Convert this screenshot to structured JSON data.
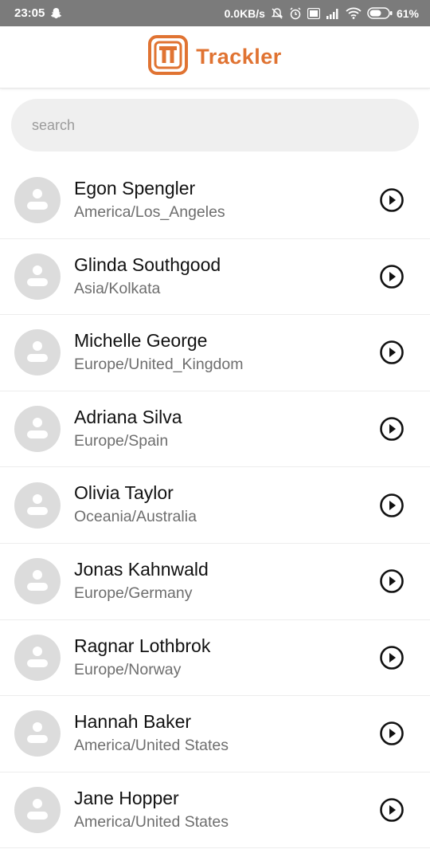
{
  "status_bar": {
    "time": "23:05",
    "speed": "0.0KB/s",
    "battery": "61%",
    "icons": [
      "snapchat-icon",
      "mute-icon",
      "alarm-icon",
      "volte-icon",
      "signal-icon",
      "wifi-icon",
      "battery-icon"
    ]
  },
  "app": {
    "brand": "Trackler",
    "brand_color": "#e07332"
  },
  "search": {
    "placeholder": "search",
    "value": ""
  },
  "contacts": [
    {
      "name": "Egon Spengler",
      "zone": "America/Los_Angeles"
    },
    {
      "name": "Glinda Southgood",
      "zone": "Asia/Kolkata"
    },
    {
      "name": "Michelle George",
      "zone": "Europe/United_Kingdom"
    },
    {
      "name": "Adriana Silva",
      "zone": "Europe/Spain"
    },
    {
      "name": "Olivia Taylor",
      "zone": "Oceania/Australia"
    },
    {
      "name": "Jonas Kahnwald",
      "zone": "Europe/Germany"
    },
    {
      "name": "Ragnar Lothbrok",
      "zone": "Europe/Norway"
    },
    {
      "name": "Hannah Baker",
      "zone": "America/United States"
    },
    {
      "name": "Jane Hopper",
      "zone": "America/United States"
    }
  ]
}
